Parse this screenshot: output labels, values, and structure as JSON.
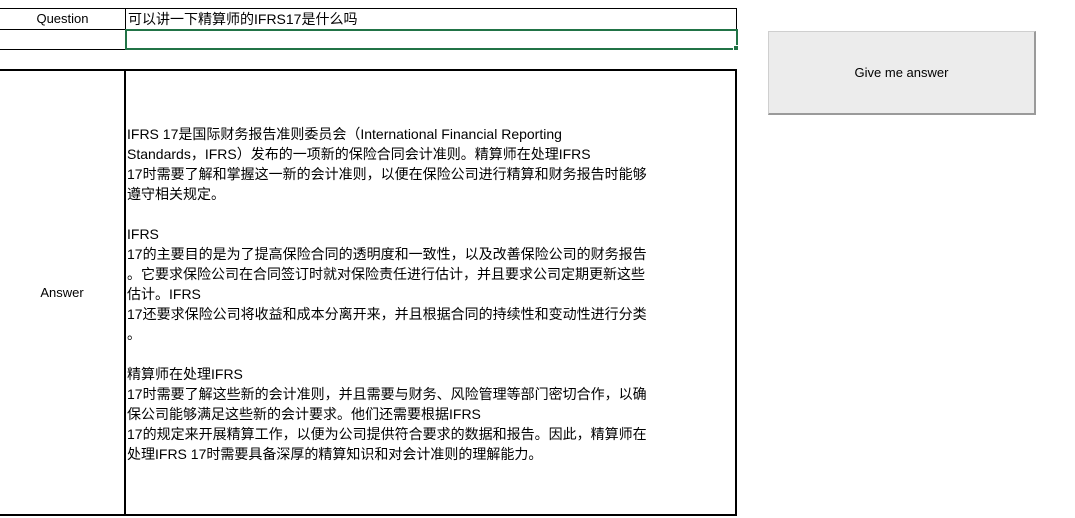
{
  "question": {
    "label": "Question",
    "value": "可以讲一下精算师的IFRS17是什么吗"
  },
  "answer": {
    "label": "Answer",
    "paragraphs": [
      [
        "IFRS 17是国际财务报告准则委员会（International Financial Reporting",
        "Standards，IFRS）发布的一项新的保险合同会计准则。精算师在处理IFRS",
        "17时需要了解和掌握这一新的会计准则，以便在保险公司进行精算和财务报告时能够",
        "遵守相关规定。"
      ],
      [
        "IFRS",
        "17的主要目的是为了提高保险合同的透明度和一致性，以及改善保险公司的财务报告",
        "。它要求保险公司在合同签订时就对保险责任进行估计，并且要求公司定期更新这些",
        "估计。IFRS",
        "17还要求保险公司将收益和成本分离开来，并且根据合同的持续性和变动性进行分类",
        "。"
      ],
      [
        "精算师在处理IFRS",
        "17时需要了解这些新的会计准则，并且需要与财务、风险管理等部门密切合作，以确",
        "保公司能够满足这些新的会计要求。他们还需要根据IFRS",
        "17的规定来开展精算工作，以便为公司提供符合要求的数据和报告。因此，精算师在",
        "处理IFRS 17时需要具备深厚的精算知识和对会计准则的理解能力。"
      ]
    ]
  },
  "button": {
    "label": "Give me answer"
  },
  "colors": {
    "selection": "#217346",
    "button_bg": "#ececec"
  }
}
